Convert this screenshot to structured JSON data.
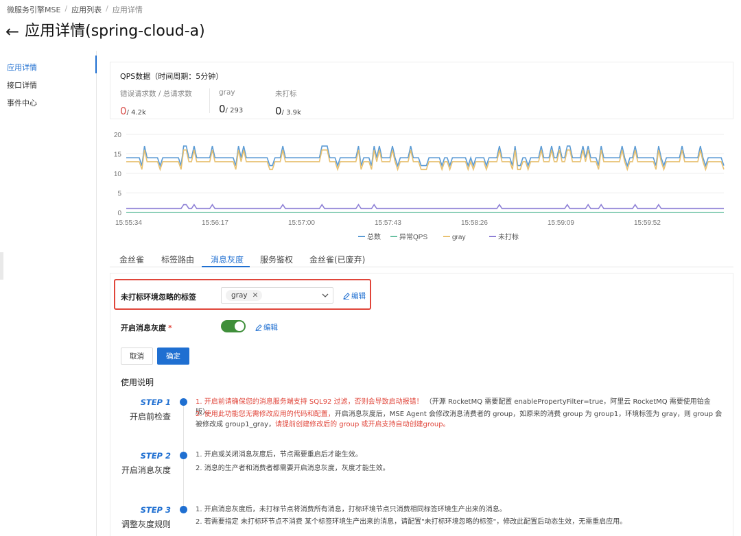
{
  "breadcrumb": {
    "items": [
      "微服务引擎MSE",
      "应用列表",
      "应用详情"
    ]
  },
  "page": {
    "back_icon": "←",
    "title": "应用详情(spring-cloud-a)"
  },
  "sidebar": {
    "items": [
      {
        "label": "应用详情",
        "active": true
      },
      {
        "label": "接口详情",
        "active": false
      },
      {
        "label": "事件中心",
        "active": false
      }
    ]
  },
  "qps": {
    "title": "QPS数据（时间周期：5分钟）",
    "stats": [
      {
        "label": "错误请求数 / 总请求数",
        "value": "0",
        "total": "/ 4.2k"
      },
      {
        "label": "gray",
        "value": "0",
        "total": "/ 293"
      },
      {
        "label": "未打标",
        "value": "0",
        "total": "/ 3.9k"
      }
    ]
  },
  "chart_data": {
    "type": "line",
    "x": [
      "15:55:34",
      "15:56:17",
      "15:57:00",
      "15:57:43",
      "15:58:26",
      "15:59:09",
      "15:59:52"
    ],
    "ylim": [
      0,
      20
    ],
    "yticks": [
      0,
      5,
      10,
      15,
      20
    ],
    "legend_position": "bottom-center",
    "series": [
      {
        "name": "总数",
        "color": "#5b9bd5",
        "baseline": 14,
        "spike_high": 17,
        "spike_low": 12
      },
      {
        "name": "异常QPS",
        "color": "#69c0a2",
        "baseline": 0
      },
      {
        "name": "gray",
        "color": "#e8c171",
        "baseline": 13,
        "spike_high": 16,
        "spike_low": 11
      },
      {
        "name": "未打标",
        "color": "#8e80d6",
        "baseline": 1,
        "spike_high": 2
      }
    ]
  },
  "tabs": [
    {
      "label": "金丝雀",
      "active": false
    },
    {
      "label": "标签路由",
      "active": false
    },
    {
      "label": "消息灰度",
      "active": true
    },
    {
      "label": "服务鉴权",
      "active": false
    },
    {
      "label": "金丝雀(已废弃)",
      "active": false
    }
  ],
  "form": {
    "ignore_tag_label": "未打标环境忽略的标签",
    "ignore_tag_value": "gray",
    "edit_label": "编辑",
    "switch_label": "开启消息灰度",
    "required_mark": "*",
    "cancel_label": "取消",
    "ok_label": "确定"
  },
  "usage": {
    "title": "使用说明",
    "steps": [
      {
        "no": "STEP 1",
        "name": "开启前检查",
        "lines": [
          {
            "red": "1. 开启前请确保您的消息服务端支持 SQL92 过滤，否则会导致启动报错！",
            "rest": " （开源 RocketMQ 需要配置 enablePropertyFilter=true，阿里云 RocketMQ 需要使用铂金版）。"
          },
          {
            "red": "2. 使用此功能您无需修改应用的代码和配置，",
            "rest": "开启消息灰度后，MSE Agent 会修改消息消费者的 group，如原来的消费 group 为 group1，环境标签为 gray，则 group 会被修改成 group1_gray，",
            "red2": "请提前创建修改后的 group 或开启支持自动创建group。"
          }
        ]
      },
      {
        "no": "STEP 2",
        "name": "开启消息灰度",
        "lines": [
          {
            "text": "1. 开启或关闭消息灰度后，节点需要重启后才能生效。"
          },
          {
            "text": "2. 消息的生产者和消费者都需要开启消息灰度，灰度才能生效。"
          }
        ]
      },
      {
        "no": "STEP 3",
        "name": "调整灰度规则",
        "lines": [
          {
            "text": "1. 开启消息灰度后，未打标节点将消费所有消息，打标环境节点只消费相同标签环境生产出来的消息。"
          },
          {
            "text": "2. 若需要指定 未打标环节点不消费 某个标签环境生产出来的消息，请配置\"未打标环境忽略的标签\"，修改此配置后动态生效，无需重启应用。"
          }
        ]
      }
    ]
  }
}
